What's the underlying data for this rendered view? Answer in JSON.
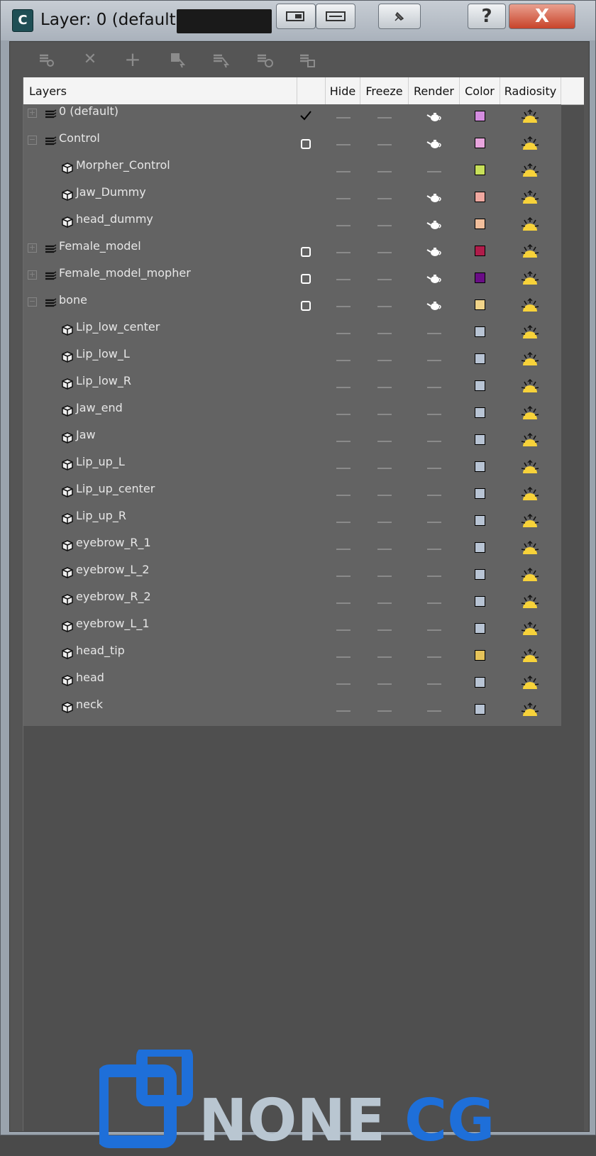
{
  "window": {
    "title": "Layer: 0 (default)"
  },
  "title_buttons": [
    "restore-panel-icon",
    "dock-icon",
    "pin-icon",
    "help-icon",
    "close-icon"
  ],
  "title_help_label": "?",
  "title_close_label": "X",
  "app_icon_letter": "C",
  "toolbar": {
    "tools": [
      "new-layer-icon",
      "delete-layer-icon",
      "add-to-layer-icon",
      "select-objects-icon",
      "select-layer-icon",
      "highlight-layer-icon",
      "hide-freeze-icon"
    ],
    "delete_label": "✕",
    "add_label": "+"
  },
  "columns": {
    "layers": "Layers",
    "hide": "Hide",
    "freeze": "Freeze",
    "render": "Render",
    "color": "Color",
    "radiosity": "Radiosity"
  },
  "rows": [
    {
      "name": "0 (default)",
      "type": "layer",
      "expander": "+",
      "current": "check",
      "render": true,
      "color": "#d58de0"
    },
    {
      "name": "Control",
      "type": "layer",
      "expander": "−",
      "current": "box",
      "render": true,
      "color": "#e8a5dd"
    },
    {
      "name": "Morpher_Control",
      "type": "object",
      "render": false,
      "color": "#c8e05a"
    },
    {
      "name": "Jaw_Dummy",
      "type": "object",
      "render": true,
      "color": "#f0a8a0"
    },
    {
      "name": "head_dummy",
      "type": "object",
      "render": true,
      "color": "#f2bf9c"
    },
    {
      "name": "Female_model",
      "type": "layer",
      "expander": "+",
      "current": "box",
      "render": true,
      "color": "#b01c4a"
    },
    {
      "name": "Female_model_mopher",
      "type": "layer",
      "expander": "+",
      "current": "box",
      "render": true,
      "color": "#6a0d86"
    },
    {
      "name": "bone",
      "type": "layer",
      "expander": "−",
      "current": "box",
      "render": true,
      "color": "#f1d489"
    },
    {
      "name": "Lip_low_center",
      "type": "object",
      "render": false,
      "color": "#b8c4d4"
    },
    {
      "name": "Lip_low_L",
      "type": "object",
      "render": false,
      "color": "#b8c4d4"
    },
    {
      "name": "Lip_low_R",
      "type": "object",
      "render": false,
      "color": "#b8c4d4"
    },
    {
      "name": "Jaw_end",
      "type": "object",
      "render": false,
      "color": "#b8c4d4"
    },
    {
      "name": "Jaw",
      "type": "object",
      "render": false,
      "color": "#b8c4d4"
    },
    {
      "name": "Lip_up_L",
      "type": "object",
      "render": false,
      "color": "#b8c4d4"
    },
    {
      "name": "Lip_up_center",
      "type": "object",
      "render": false,
      "color": "#b8c4d4"
    },
    {
      "name": "Lip_up_R",
      "type": "object",
      "render": false,
      "color": "#b8c4d4"
    },
    {
      "name": "eyebrow_R_1",
      "type": "object",
      "render": false,
      "color": "#b8c4d4"
    },
    {
      "name": "eyebrow_L_2",
      "type": "object",
      "render": false,
      "color": "#b8c4d4"
    },
    {
      "name": "eyebrow_R_2",
      "type": "object",
      "render": false,
      "color": "#b8c4d4"
    },
    {
      "name": "eyebrow_L_1",
      "type": "object",
      "render": false,
      "color": "#b8c4d4"
    },
    {
      "name": "head_tip",
      "type": "object",
      "render": false,
      "color": "#e6c35a"
    },
    {
      "name": "head",
      "type": "object",
      "render": false,
      "color": "#b8c4d4"
    },
    {
      "name": "neck",
      "type": "object",
      "render": false,
      "color": "#b8c4d4"
    }
  ],
  "logo": {
    "text_left": "NONE",
    "text_right": "CG",
    "left_color": "#b9c6d1",
    "right_color": "#1e6fd9",
    "icon_color": "#1e6fd9"
  }
}
